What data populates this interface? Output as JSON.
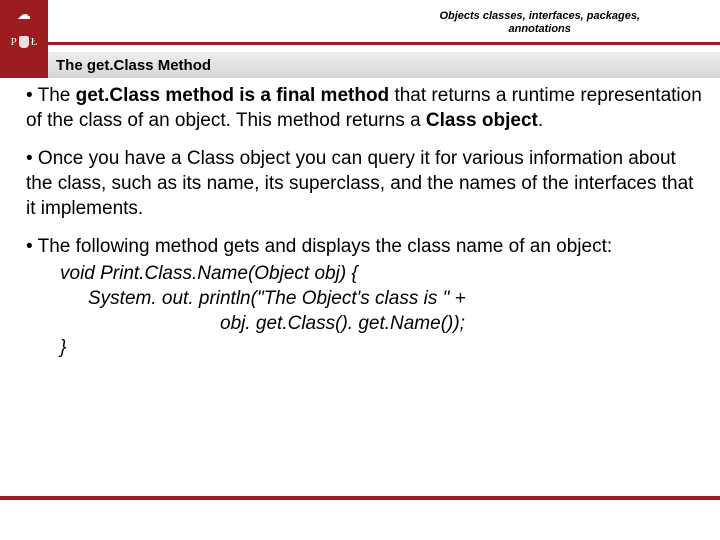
{
  "header": {
    "topic_line1": "Objects classes, interfaces, packages,",
    "topic_line2": "annotations",
    "logo_letter_left": "P",
    "logo_letter_right": "Ł"
  },
  "subheader": {
    "title": "The get.Class Method"
  },
  "bullets": {
    "b1_prefix": " • The ",
    "b1_bold1": "get.Class method is a final method",
    "b1_mid": " that returns a runtime representation of the class of an object. This method returns a ",
    "b1_bold2": "Class object",
    "b1_suffix": ".",
    "b2": " • Once you have a Class object you can query it for various information about the class, such as its name, its superclass, and the names of the interfaces that it implements.",
    "b3": " • The following method gets and displays the class name of an object:"
  },
  "code": {
    "l1": "void Print.Class.Name(Object obj) {",
    "l2": "System. out. println(\"The Object's class is \" +",
    "l3": "obj. get.Class(). get.Name());",
    "l4": "}"
  }
}
